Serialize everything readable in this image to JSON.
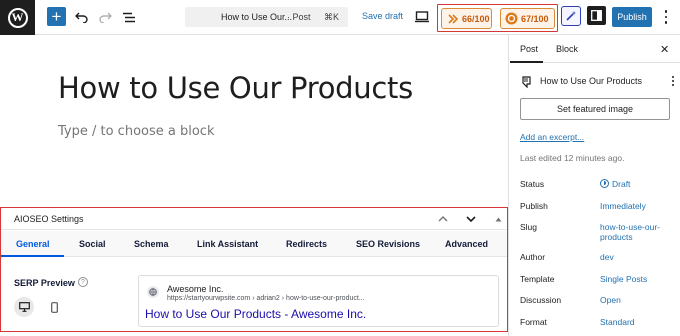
{
  "toolbar": {
    "add_block_label": "+",
    "document_title": "How to Use Our...",
    "document_type": "· Post",
    "command_shortcut": "⌘K",
    "save_draft_label": "Save draft",
    "scores": [
      {
        "value": "66/100",
        "icon": "truseo-score-icon"
      },
      {
        "value": "67/100",
        "icon": "headline-score-icon"
      }
    ],
    "publish_label": "Publish"
  },
  "editor": {
    "post_title": "How to Use Our Products",
    "block_placeholder": "Type / to choose a block"
  },
  "aioseo": {
    "panel_title": "AIOSEO Settings",
    "tabs": [
      {
        "label": "General",
        "active": true
      },
      {
        "label": "Social"
      },
      {
        "label": "Schema"
      },
      {
        "label": "Link Assistant"
      },
      {
        "label": "Redirects"
      },
      {
        "label": "SEO Revisions"
      },
      {
        "label": "Advanced"
      }
    ],
    "serp_label": "SERP Preview",
    "help_glyph": "?",
    "serp": {
      "site_name": "Awesome Inc.",
      "url": "https://startyourwpsite.com › adrian2 › how-to-use-our-product...",
      "headline": "How to Use Our Products - Awesome Inc."
    }
  },
  "sidebar": {
    "tabs": [
      {
        "label": "Post",
        "active": true
      },
      {
        "label": "Block"
      }
    ],
    "close_glyph": "✕",
    "post_summary_title": "How to Use Our Products",
    "featured_image_label": "Set featured image",
    "excerpt_link": "Add an excerpt...",
    "last_edited": "Last edited 12 minutes ago.",
    "meta": [
      {
        "key": "Status",
        "value": "Draft"
      },
      {
        "key": "Publish",
        "value": "Immediately"
      },
      {
        "key": "Slug",
        "value": "how-to-use-our-products"
      },
      {
        "key": "Author",
        "value": "dev"
      },
      {
        "key": "Template",
        "value": "Single Posts"
      },
      {
        "key": "Discussion",
        "value": "Open"
      },
      {
        "key": "Format",
        "value": "Standard"
      }
    ]
  },
  "colors": {
    "accent_blue": "#2271b1",
    "score_orange": "#c8590a",
    "highlight_red": "#d63638",
    "aioseo_blue": "#005ae0",
    "serp_link": "#1a0dab"
  }
}
